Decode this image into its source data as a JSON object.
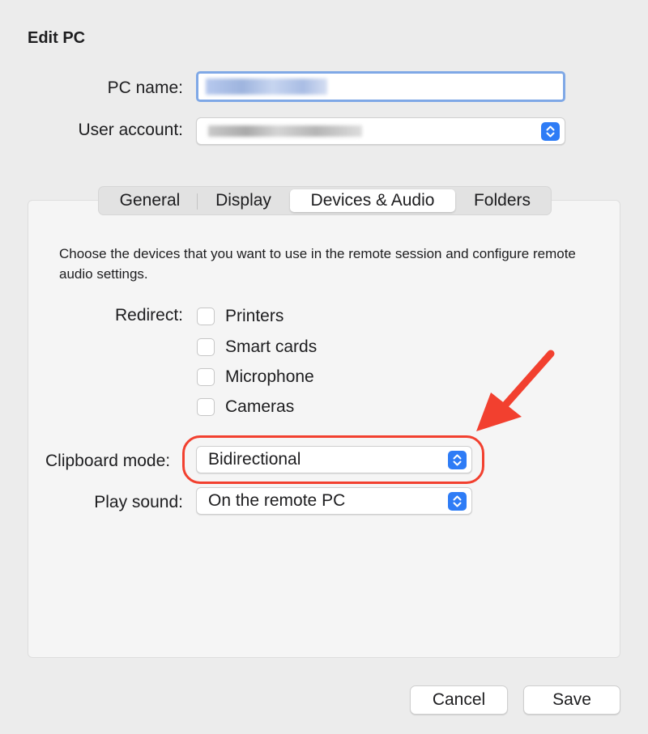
{
  "dialog": {
    "title": "Edit PC"
  },
  "form": {
    "pc_name_label": "PC name:",
    "pc_name_value": "",
    "user_account_label": "User account:"
  },
  "tabs": [
    {
      "label": "General",
      "selected": false
    },
    {
      "label": "Display",
      "selected": false
    },
    {
      "label": "Devices & Audio",
      "selected": true
    },
    {
      "label": "Folders",
      "selected": false
    }
  ],
  "devices_audio": {
    "description": "Choose the devices that you want to use in the remote session and configure remote audio settings.",
    "redirect_label": "Redirect:",
    "redirect_options": [
      {
        "label": "Printers",
        "checked": false
      },
      {
        "label": "Smart cards",
        "checked": false
      },
      {
        "label": "Microphone",
        "checked": false
      },
      {
        "label": "Cameras",
        "checked": false
      }
    ],
    "clipboard_mode_label": "Clipboard mode:",
    "clipboard_mode_value": "Bidirectional",
    "play_sound_label": "Play sound:",
    "play_sound_value": "On the remote PC"
  },
  "buttons": {
    "cancel": "Cancel",
    "save": "Save"
  },
  "annotation": {
    "color": "#f2402f"
  },
  "colors": {
    "accent": "#2e7cf6",
    "focus_ring": "#7fa8e6"
  },
  "icons": {
    "stepper": "up-down-chevron-icon",
    "arrow": "red-arrow-icon"
  }
}
